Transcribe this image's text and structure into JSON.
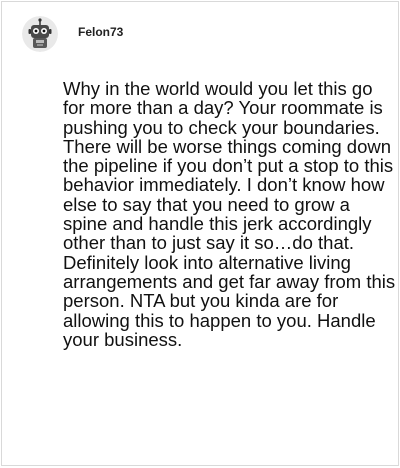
{
  "comment": {
    "author": {
      "username": "Felon73",
      "avatar_icon": "robot-avatar-icon"
    },
    "text": "Why in the world would you let this go for more than a day? Your roommate is pushing you to check your boundaries. There will be worse things coming down the pipeline if you don’t put a stop to this behavior immediately. I don’t know how else to say that you need to grow a spine and handle this jerk accordingly other than to just say it so…do that. Definitely look into alternative living arrangements and get far away from this person. NTA but you kinda are for allowing this to happen to you. Handle your business."
  }
}
